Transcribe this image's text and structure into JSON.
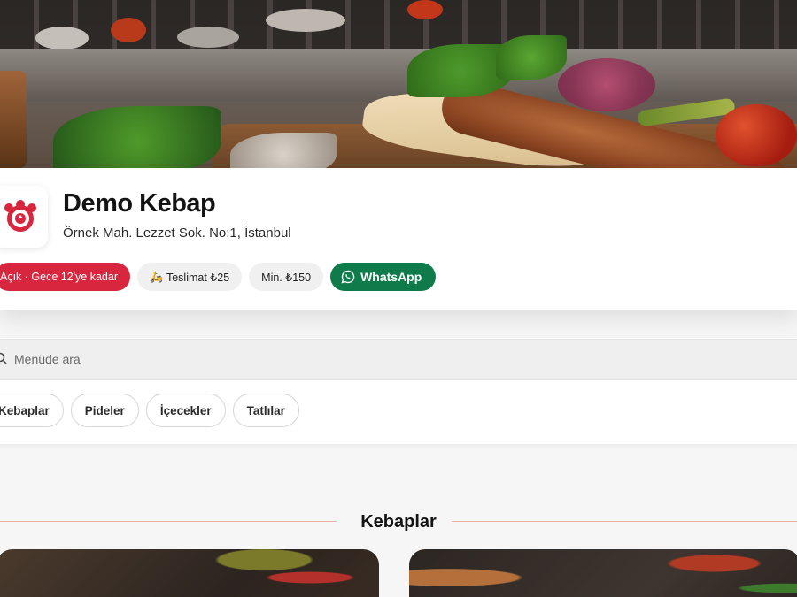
{
  "restaurant": {
    "name": "Demo Kebap",
    "address": "Örnek Mah. Lezzet Sok. No:1, İstanbul"
  },
  "chips": {
    "open": "Açık · Gece 12'ye kadar",
    "delivery": "Teslimat ₺25",
    "minimum": "Min. ₺150",
    "whatsapp": "WhatsApp"
  },
  "search": {
    "placeholder": "Menüde ara"
  },
  "categories": [
    {
      "label": "Kebaplar"
    },
    {
      "label": "Pideler"
    },
    {
      "label": "İçecekler"
    },
    {
      "label": "Tatlılar"
    }
  ],
  "section": {
    "title": "Kebaplar"
  },
  "colors": {
    "open_badge": "#d7263d",
    "whatsapp": "#0f7a4a",
    "chip_bg": "#f0f0f0",
    "search_bg": "#efefef",
    "section_line": "#e9b1a6"
  },
  "icons": {
    "logo": "restaurant-logo-icon",
    "delivery": "scooter-icon",
    "whatsapp": "whatsapp-icon",
    "search": "search-icon"
  }
}
